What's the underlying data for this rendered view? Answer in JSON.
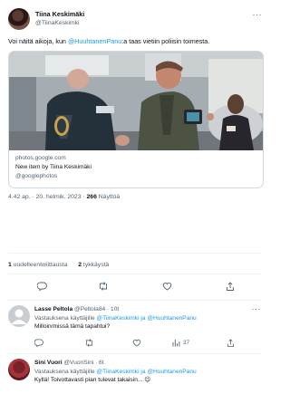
{
  "tweet": {
    "author_name": "Tiina Keskimäki",
    "author_handle": "@TiinaKeskimki",
    "text_before": "Voi näitä aikoja, kun ",
    "text_mention": "@HuuhtanenPanu",
    "text_after": ":a taas vietiin poliisin toimesta.",
    "card": {
      "domain": "photos.google.com",
      "title": "New item by Tiina Keskimäki",
      "source": "@googlephotos"
    },
    "time": "4.42 ap. · 20. helmik. 2023 · ",
    "views_count": "266",
    "views_label": " Näyttöä",
    "retweets_count": "1",
    "retweets_label": " uudelleentwiittausta",
    "likes_count": "2",
    "likes_label": " tykkäystä"
  },
  "replies": [
    {
      "name": "Lasse Peltola",
      "meta": " @Peltola84 · 10t",
      "replying_prefix": "Vastauksena käyttäjille ",
      "replying_to": "@TiinaKeskimki ja @HuuhtanenPanu",
      "text": "Milloin/missä tämä tapahtui?",
      "views": "37"
    },
    {
      "name": "Sini Vuori",
      "meta": " @VuoriSini · 6t",
      "replying_prefix": "Vastauksena käyttäjille ",
      "replying_to": "@TiinaKeskimki ja @HuuhtanenPanu",
      "text": "Kyllä! Toivottavasti pian tulevat takaisin... 😉"
    }
  ],
  "colors": {
    "accent": "#1d9bf0",
    "muted": "#536471",
    "text": "#0f1419",
    "border": "#cfd9de"
  },
  "icons": [
    "more-icon",
    "reply-icon",
    "retweet-icon",
    "like-icon",
    "share-icon",
    "views-icon"
  ]
}
